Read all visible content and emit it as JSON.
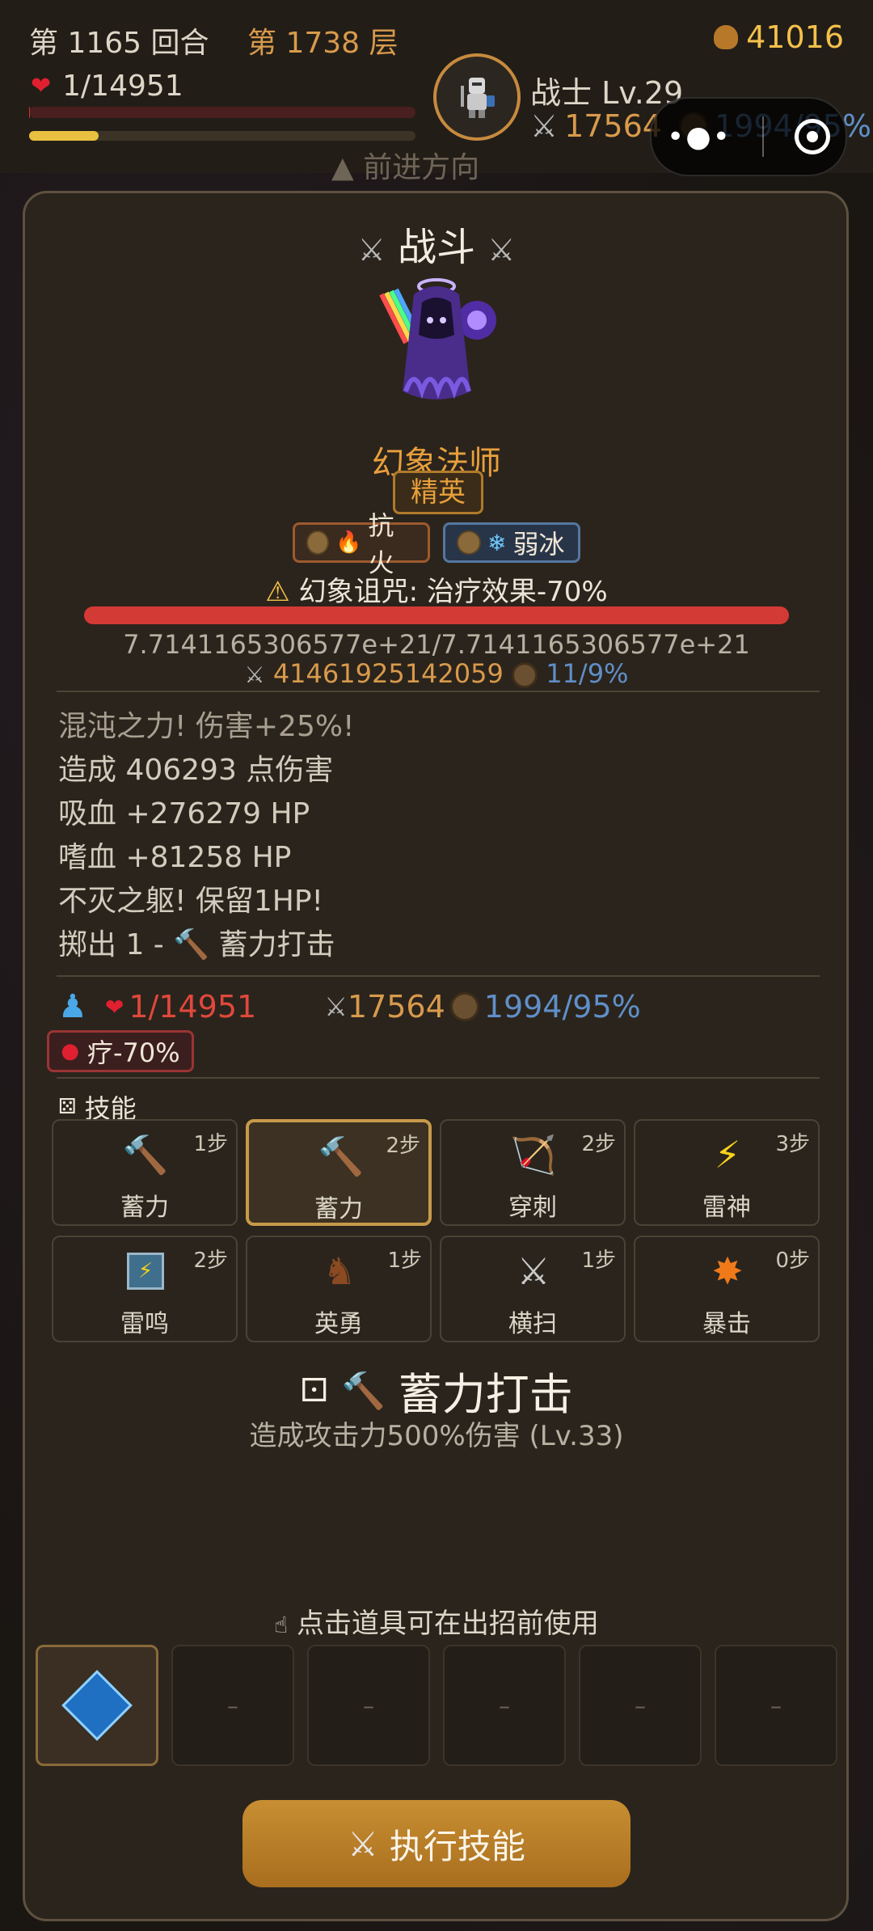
{
  "header": {
    "round": "第 1165 回合",
    "floor": "第 1738 层",
    "gold": "41016",
    "hp": "1/14951",
    "hp_fraction": 0.0001,
    "xp_fraction": 0.18,
    "class_level": "战士 Lv.29",
    "attack": "17564",
    "defense": "1994/95%",
    "direction": "前进方向"
  },
  "battle": {
    "title": "战斗",
    "monster_name": "幻象法师",
    "rank": "精英",
    "tag_fire": "抗火",
    "tag_ice": "弱冰",
    "curse": "幻象诅咒: 治疗效果-70%",
    "boss_hp": "7.7141165306577e+21/7.7141165306577e+21",
    "boss_attack": "41461925142059",
    "boss_defense": "11/9%"
  },
  "log": [
    "混沌之力! 伤害+25%!",
    "造成 406293 点伤害",
    "吸血 +276279 HP",
    "嗜血 +81258 HP",
    "不灭之躯! 保留1HP!",
    "掷出 1 - 🔨 蓄力打击"
  ],
  "player": {
    "hp": "1/14951",
    "attack": "17564",
    "defense": "1994/95%",
    "heal_debuff": "疗-70%"
  },
  "skills_title": "技能",
  "skills": [
    {
      "name": "蓄力",
      "steps": "1步",
      "icon": "hammer-icon"
    },
    {
      "name": "蓄力",
      "steps": "2步",
      "icon": "hammer-icon"
    },
    {
      "name": "穿刺",
      "steps": "2步",
      "icon": "bow-icon"
    },
    {
      "name": "雷神",
      "steps": "3步",
      "icon": "lightning-icon"
    },
    {
      "name": "雷鸣",
      "steps": "2步",
      "icon": "thunder-rune-icon"
    },
    {
      "name": "英勇",
      "steps": "1步",
      "icon": "horse-icon"
    },
    {
      "name": "横扫",
      "steps": "1步",
      "icon": "crossed-swords-icon"
    },
    {
      "name": "暴击",
      "steps": "0步",
      "icon": "explosion-icon"
    }
  ],
  "chosen_skill": {
    "name": "蓄力打击",
    "desc": "造成攻击力500%伤害 (Lv.33)"
  },
  "items_hint": "点击道具可在出招前使用",
  "empty_slot": "–",
  "exec_button": "执行技能"
}
